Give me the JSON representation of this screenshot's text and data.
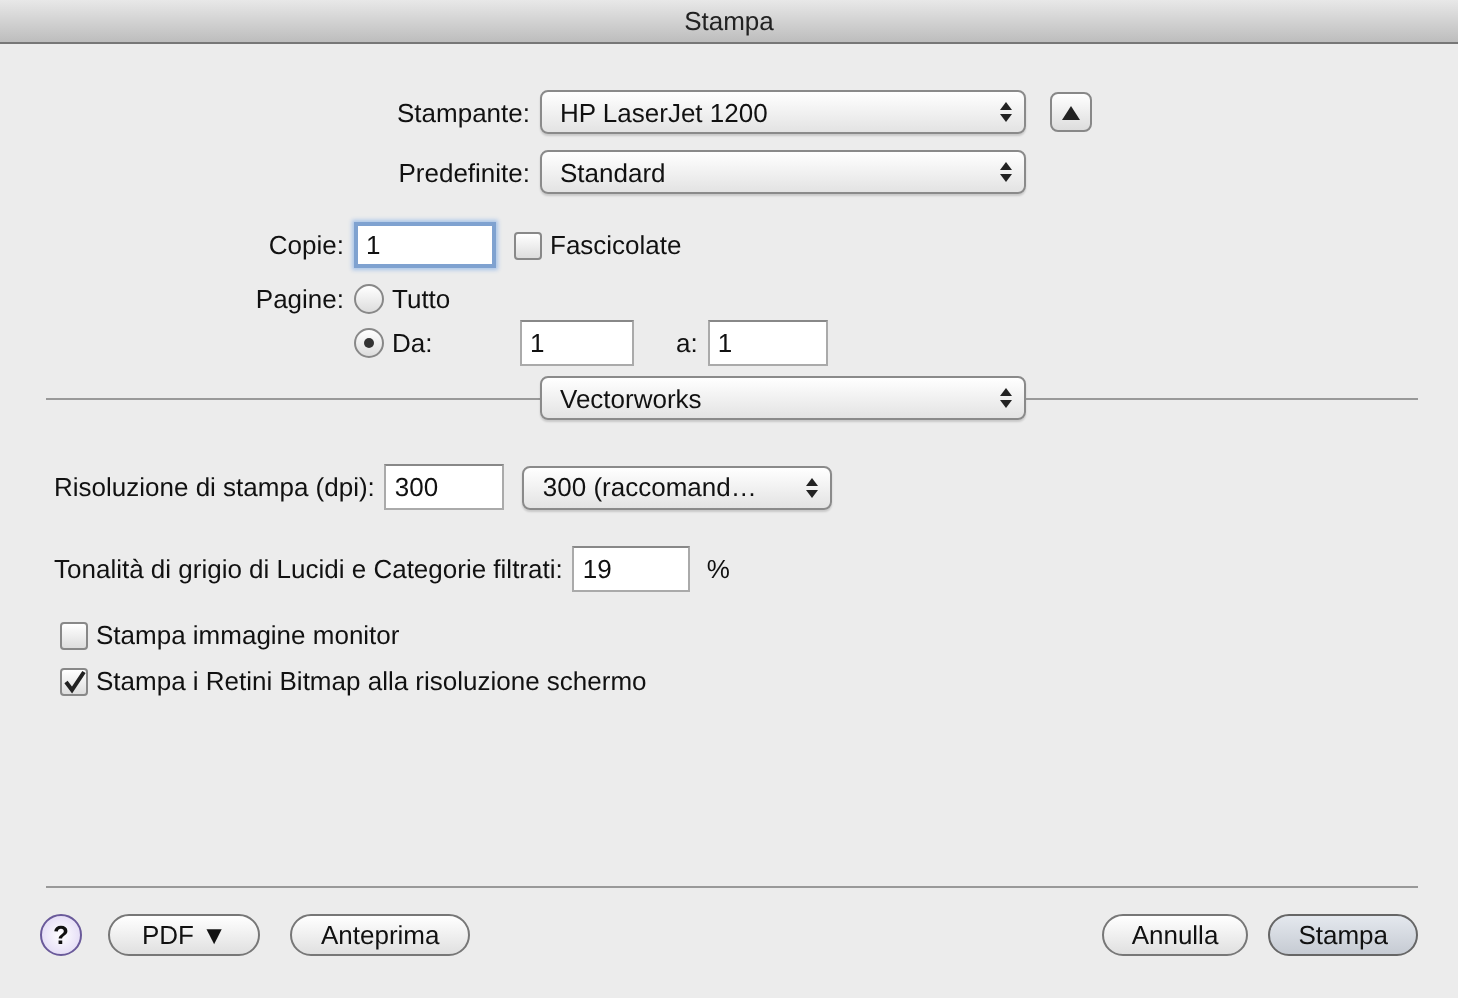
{
  "window": {
    "title": "Stampa"
  },
  "printer": {
    "label": "Stampante:",
    "value": "HP LaserJet 1200"
  },
  "presets": {
    "label": "Predefinite:",
    "value": "Standard"
  },
  "copies": {
    "label": "Copie:",
    "value": "1",
    "focused": true,
    "collated": {
      "label": "Fascicolate",
      "checked": false
    }
  },
  "pages": {
    "label": "Pagine:",
    "options": [
      {
        "label": "Tutto",
        "selected": false
      },
      {
        "label": "Da:",
        "selected": true
      }
    ],
    "from": "1",
    "to_label": "a:",
    "to": "1"
  },
  "panel": {
    "value": "Vectorworks"
  },
  "resolution": {
    "label": "Risoluzione di stampa (dpi):",
    "value": "300",
    "popup": "300 (raccomand…"
  },
  "shade": {
    "label": "Tonalità di grigio di Lucidi e Categorie filtrati:",
    "value": "19",
    "unit": "%"
  },
  "options": [
    {
      "label": "Stampa immagine monitor",
      "checked": false
    },
    {
      "label": "Stampa i Retini Bitmap alla risoluzione schermo",
      "checked": true
    }
  ],
  "help": "?",
  "left_buttons": [
    {
      "label": "PDF ▼",
      "kind": "menu"
    },
    {
      "label": "Anteprima",
      "kind": "plain"
    }
  ],
  "right_buttons": [
    {
      "label": "Annulla",
      "kind": "plain"
    },
    {
      "label": "Stampa",
      "kind": "default"
    }
  ]
}
